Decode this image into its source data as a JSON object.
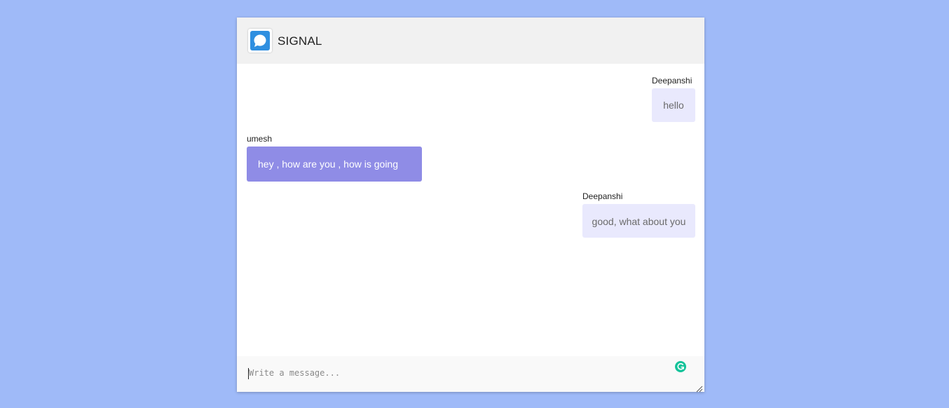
{
  "app": {
    "title": "SIGNAL",
    "logo_icon": "chat-bubble-icon",
    "logo_color": "#2f8fe0"
  },
  "messages": [
    {
      "sender": "Deepanshi",
      "text": "hello",
      "direction": "outgoing"
    },
    {
      "sender": "umesh",
      "text": "hey , how are you , how is going",
      "direction": "incoming"
    },
    {
      "sender": "Deepanshi",
      "text": "good, what about you",
      "direction": "outgoing"
    }
  ],
  "composer": {
    "placeholder": "Write a message...",
    "value": ""
  },
  "colors": {
    "background": "#9fbaf8",
    "outgoing_bubble": "#e9e9fd",
    "incoming_bubble": "#8f8ce6",
    "grammar_badge": "#15c39a"
  }
}
